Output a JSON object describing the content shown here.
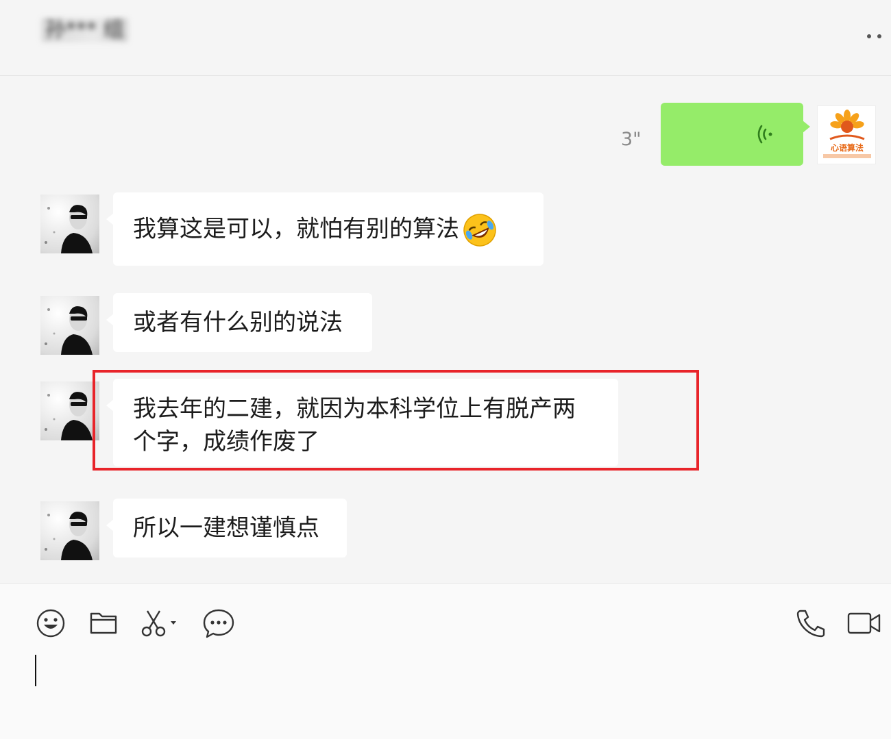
{
  "header": {
    "title": "孙*** 组"
  },
  "voice_message": {
    "duration": "3\""
  },
  "self_avatar": {
    "logo_text": "心语算法"
  },
  "messages": [
    {
      "text": "我算这是可以，就怕有别的算法",
      "emoji": "rolling-on-floor-laughing"
    },
    {
      "text": "或者有什么别的说法"
    },
    {
      "line1": "我去年的二建，就因为本科学位上有脱产两",
      "line2": "个字，成绩作废了",
      "highlighted": true
    },
    {
      "text": "所以一建想谨慎点"
    }
  ],
  "colors": {
    "self_bubble": "#95ec69",
    "highlight_border": "#e8242a",
    "background": "#f5f5f5"
  },
  "toolbar_icons": [
    "emoji-icon",
    "folder-icon",
    "scissors-icon",
    "chat-history-icon",
    "phone-icon",
    "video-call-icon"
  ]
}
